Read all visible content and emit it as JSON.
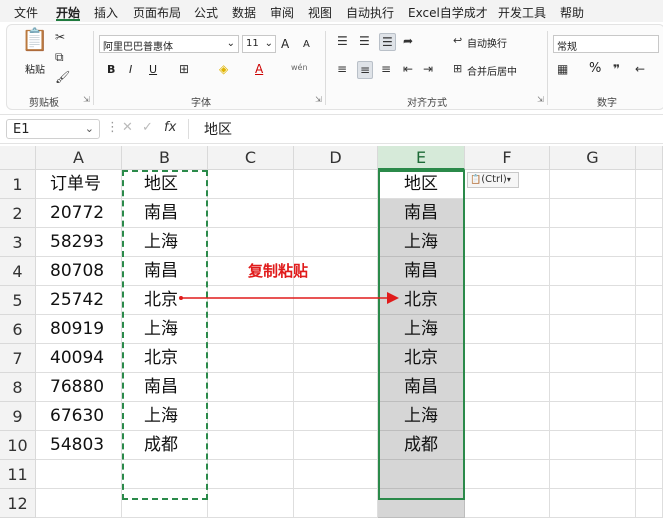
{
  "menu": [
    "文件",
    "开始",
    "插入",
    "页面布局",
    "公式",
    "数据",
    "审阅",
    "视图",
    "自动执行",
    "Excel自学成才",
    "开发工具",
    "帮助"
  ],
  "ribbon": {
    "paste_label": "粘贴",
    "font_name": "阿里巴巴普惠体",
    "font_size": "11",
    "font_bold": "B",
    "font_italic": "I",
    "font_underline": "U",
    "grow_font": "A",
    "shrink_font": "A",
    "font_color_letter": "A",
    "wen": "wén",
    "wrap_text": "自动换行",
    "merge_center": "合并后居中",
    "number_format": "常规",
    "percent": "%",
    "groups": {
      "clipboard": "剪贴板",
      "font": "字体",
      "alignment": "对齐方式",
      "number": "数字"
    }
  },
  "formula_bar": {
    "cell_ref": "E1",
    "fx": "fx",
    "content": "地区"
  },
  "columns": [
    "A",
    "B",
    "C",
    "D",
    "E",
    "F",
    "G"
  ],
  "rows": [
    "1",
    "2",
    "3",
    "4",
    "5",
    "6",
    "7",
    "8",
    "9",
    "10",
    "11",
    "12"
  ],
  "sheet": {
    "A": [
      "订单号",
      "20772",
      "58293",
      "80708",
      "25742",
      "80919",
      "40094",
      "76880",
      "67630",
      "54803"
    ],
    "B": [
      "地区",
      "南昌",
      "上海",
      "南昌",
      "北京",
      "上海",
      "北京",
      "南昌",
      "上海",
      "成都"
    ],
    "E": [
      "地区",
      "南昌",
      "上海",
      "南昌",
      "北京",
      "上海",
      "北京",
      "南昌",
      "上海",
      "成都"
    ]
  },
  "paste_options_label": "(Ctrl)",
  "annotation": "复制粘贴",
  "colors": {
    "accent": "#2b8a4a",
    "annotation": "#e01b1b",
    "selected_fill": "#d6d6d6"
  }
}
